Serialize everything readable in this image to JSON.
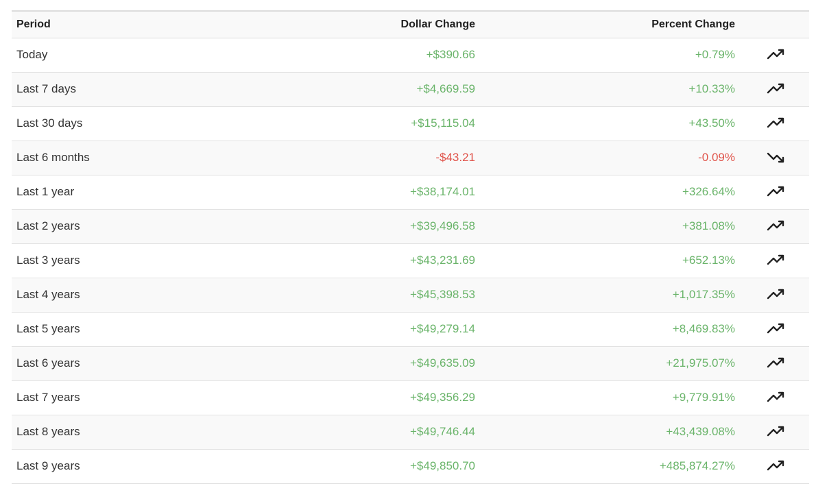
{
  "table": {
    "headers": {
      "period": "Period",
      "dollar": "Dollar Change",
      "percent": "Percent Change"
    },
    "rows": [
      {
        "period": "Today",
        "dollar": "+$390.66",
        "percent": "+0.79%",
        "trend": "trending-up-icon",
        "direction": "up"
      },
      {
        "period": "Last 7 days",
        "dollar": "+$4,669.59",
        "percent": "+10.33%",
        "trend": "trending-up-icon",
        "direction": "up"
      },
      {
        "period": "Last 30 days",
        "dollar": "+$15,115.04",
        "percent": "+43.50%",
        "trend": "trending-up-icon",
        "direction": "up"
      },
      {
        "period": "Last 6 months",
        "dollar": "-$43.21",
        "percent": "-0.09%",
        "trend": "trending-down-icon",
        "direction": "down"
      },
      {
        "period": "Last 1 year",
        "dollar": "+$38,174.01",
        "percent": "+326.64%",
        "trend": "trending-up-icon",
        "direction": "up"
      },
      {
        "period": "Last 2 years",
        "dollar": "+$39,496.58",
        "percent": "+381.08%",
        "trend": "trending-up-icon",
        "direction": "up"
      },
      {
        "period": "Last 3 years",
        "dollar": "+$43,231.69",
        "percent": "+652.13%",
        "trend": "trending-up-icon",
        "direction": "up"
      },
      {
        "period": "Last 4 years",
        "dollar": "+$45,398.53",
        "percent": "+1,017.35%",
        "trend": "trending-up-icon",
        "direction": "up"
      },
      {
        "period": "Last 5 years",
        "dollar": "+$49,279.14",
        "percent": "+8,469.83%",
        "trend": "trending-up-icon",
        "direction": "up"
      },
      {
        "period": "Last 6 years",
        "dollar": "+$49,635.09",
        "percent": "+21,975.07%",
        "trend": "trending-up-icon",
        "direction": "up"
      },
      {
        "period": "Last 7 years",
        "dollar": "+$49,356.29",
        "percent": "+9,779.91%",
        "trend": "trending-up-icon",
        "direction": "up"
      },
      {
        "period": "Last 8 years",
        "dollar": "+$49,746.44",
        "percent": "+43,439.08%",
        "trend": "trending-up-icon",
        "direction": "up"
      },
      {
        "period": "Last 9 years",
        "dollar": "+$49,850.70",
        "percent": "+485,874.27%",
        "trend": "trending-up-icon",
        "direction": "up"
      }
    ]
  },
  "colors": {
    "positive": "#6ab46a",
    "negative": "#e0534a",
    "header_text": "#222222",
    "period_text": "#333333",
    "icon": "#222222"
  }
}
